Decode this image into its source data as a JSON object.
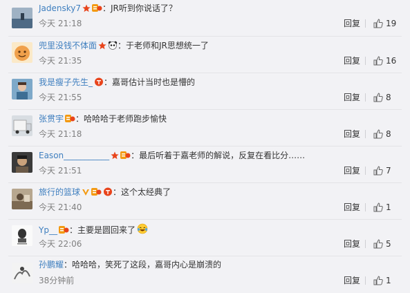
{
  "reply_label": "回复",
  "colors": {
    "username": "#3f7fbf",
    "time": "#808080",
    "vip_star": "#e8441b",
    "badge_orange": "#f39a12",
    "badge_red": "#e8441b"
  },
  "comments": [
    {
      "username": "Jadensky7",
      "text": "：JR听到你说话了？",
      "time": "今天 21:18",
      "likes": "19",
      "badges": [
        "vip-star",
        "member-badge"
      ]
    },
    {
      "username": "兜里没钱不体面",
      "text": "：于老师和JR思想统一了",
      "time": "今天 21:35",
      "likes": "16",
      "badges": [
        "vip-star",
        "panda-badge"
      ]
    },
    {
      "username": "我是瘦子先生_",
      "text": "：嘉哥估计当时也是懵的",
      "time": "今天 21:55",
      "likes": "8",
      "badges": [
        "red-badge"
      ]
    },
    {
      "username": "张贯宇",
      "text": "：哈哈哈于老师跑步愉快",
      "time": "今天 21:18",
      "likes": "8",
      "badges": [
        "member-badge"
      ]
    },
    {
      "username": "Eason___________",
      "text": "：最后听着于嘉老师的解说，反复在看比分……",
      "time": "今天 21:51",
      "likes": "7",
      "badges": [
        "vip-star",
        "member-badge"
      ]
    },
    {
      "username": "旅行的篮球",
      "text": "：这个太经典了",
      "time": "今天 21:40",
      "likes": "1",
      "badges": [
        "v-badge",
        "member-badge",
        "red-badge"
      ]
    },
    {
      "username": "Yp__",
      "text": "：主要是圆回来了",
      "time": "今天 22:06",
      "likes": "5",
      "badges": [
        "member-badge"
      ],
      "emoji": "laugh-cry-emoji"
    },
    {
      "username": "孙鹏耀",
      "text": "：哈哈哈，笑死了这段，嘉哥内心是崩溃的",
      "time": "38分钟前",
      "likes": "1",
      "badges": []
    }
  ]
}
